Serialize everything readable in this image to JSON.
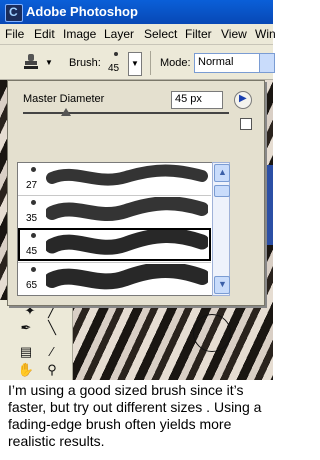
{
  "window": {
    "title": "Adobe Photoshop",
    "icon": "photoshop-app-icon",
    "icon_glyph": "C"
  },
  "menu": [
    "File",
    "Edit",
    "Image",
    "Layer",
    "Select",
    "Filter",
    "View",
    "Win"
  ],
  "options_bar": {
    "brush_label": "Brush:",
    "brush_size": "45",
    "mode_label": "Mode:",
    "mode_value": "Normal"
  },
  "brush_palette": {
    "master_diameter_label": "Master Diameter",
    "master_diameter_value": "45 px",
    "presets": [
      {
        "size": "27",
        "selected": false
      },
      {
        "size": "35",
        "selected": false
      },
      {
        "size": "45",
        "selected": true
      },
      {
        "size": "65",
        "selected": false
      }
    ]
  },
  "caption": "I’m using a good sized brush since it’s faster, but try out different sizes . Using a fading-edge brush often yields more realistic results.",
  "colors": {
    "title_bar": "#0a5fd8",
    "menu_bg": "#ece9d8",
    "palette_bg": "#e4e0cf"
  }
}
